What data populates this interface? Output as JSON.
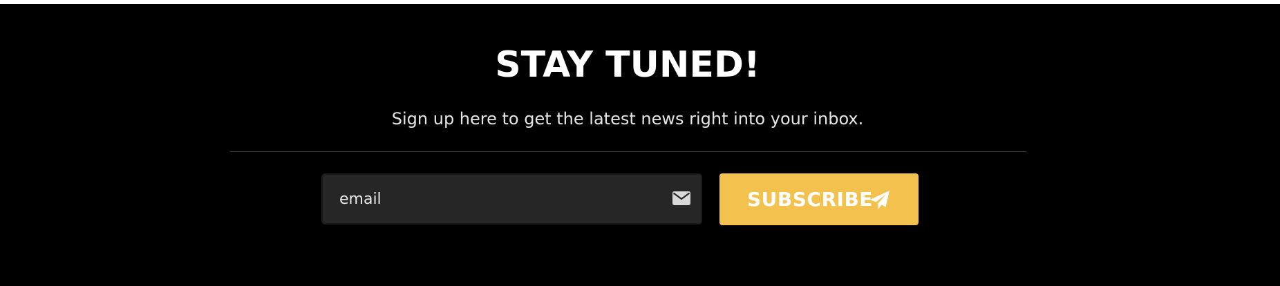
{
  "newsletter": {
    "title": "STAY TUNED!",
    "subtitle": "Sign up here to get the latest news right into your inbox.",
    "email_placeholder": "email",
    "email_value": "",
    "email_icon": "envelope-icon",
    "subscribe_label": "SUBSCRIBE",
    "subscribe_icon": "paper-plane-icon"
  },
  "colors": {
    "background": "#000000",
    "accent": "#f2c14e",
    "input_bg": "#262626",
    "text": "#ffffff",
    "subtitle_text": "#e6e6e6",
    "divider": "#3a3a3a"
  }
}
